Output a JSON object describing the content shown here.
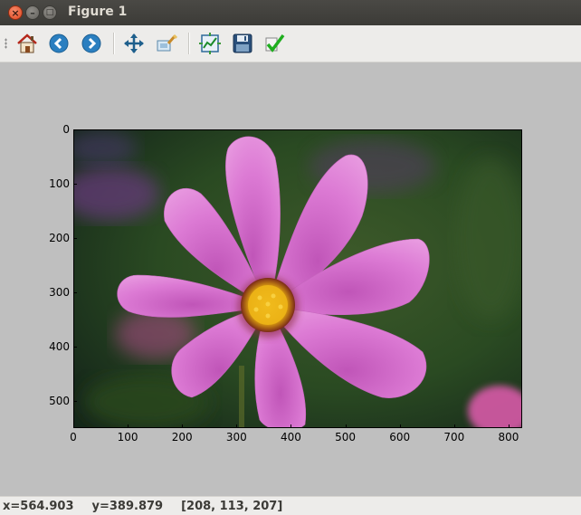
{
  "window": {
    "title": "Figure 1",
    "close_glyph": "×",
    "minimize_glyph": "–",
    "maximize_glyph": "□"
  },
  "toolbar": {
    "tools": [
      {
        "name": "home-icon",
        "tooltip": "Home"
      },
      {
        "name": "back-icon",
        "tooltip": "Back"
      },
      {
        "name": "forward-icon",
        "tooltip": "Forward"
      },
      {
        "name": "pan-icon",
        "tooltip": "Pan"
      },
      {
        "name": "zoom-icon",
        "tooltip": "Zoom"
      },
      {
        "name": "subplots-icon",
        "tooltip": "Configure subplots"
      },
      {
        "name": "save-icon",
        "tooltip": "Save"
      },
      {
        "name": "edit-axes-icon",
        "tooltip": "Edit axis"
      }
    ]
  },
  "plot": {
    "image_subject": "pink cosmos flower photograph",
    "x_ticks": [
      "0",
      "100",
      "200",
      "300",
      "400",
      "500",
      "600",
      "700",
      "800"
    ],
    "y_ticks": [
      "0",
      "100",
      "200",
      "300",
      "400",
      "500"
    ],
    "x_range": [
      0,
      825
    ],
    "y_range": [
      0,
      550
    ]
  },
  "status": {
    "x_readout": "x=564.903",
    "y_readout": "y=389.879",
    "pixel_value": "[208, 113, 207]"
  },
  "colors": {
    "petal": "#d96fd0",
    "center": "#e8b81a",
    "background_dark": "#1f3a1c"
  }
}
